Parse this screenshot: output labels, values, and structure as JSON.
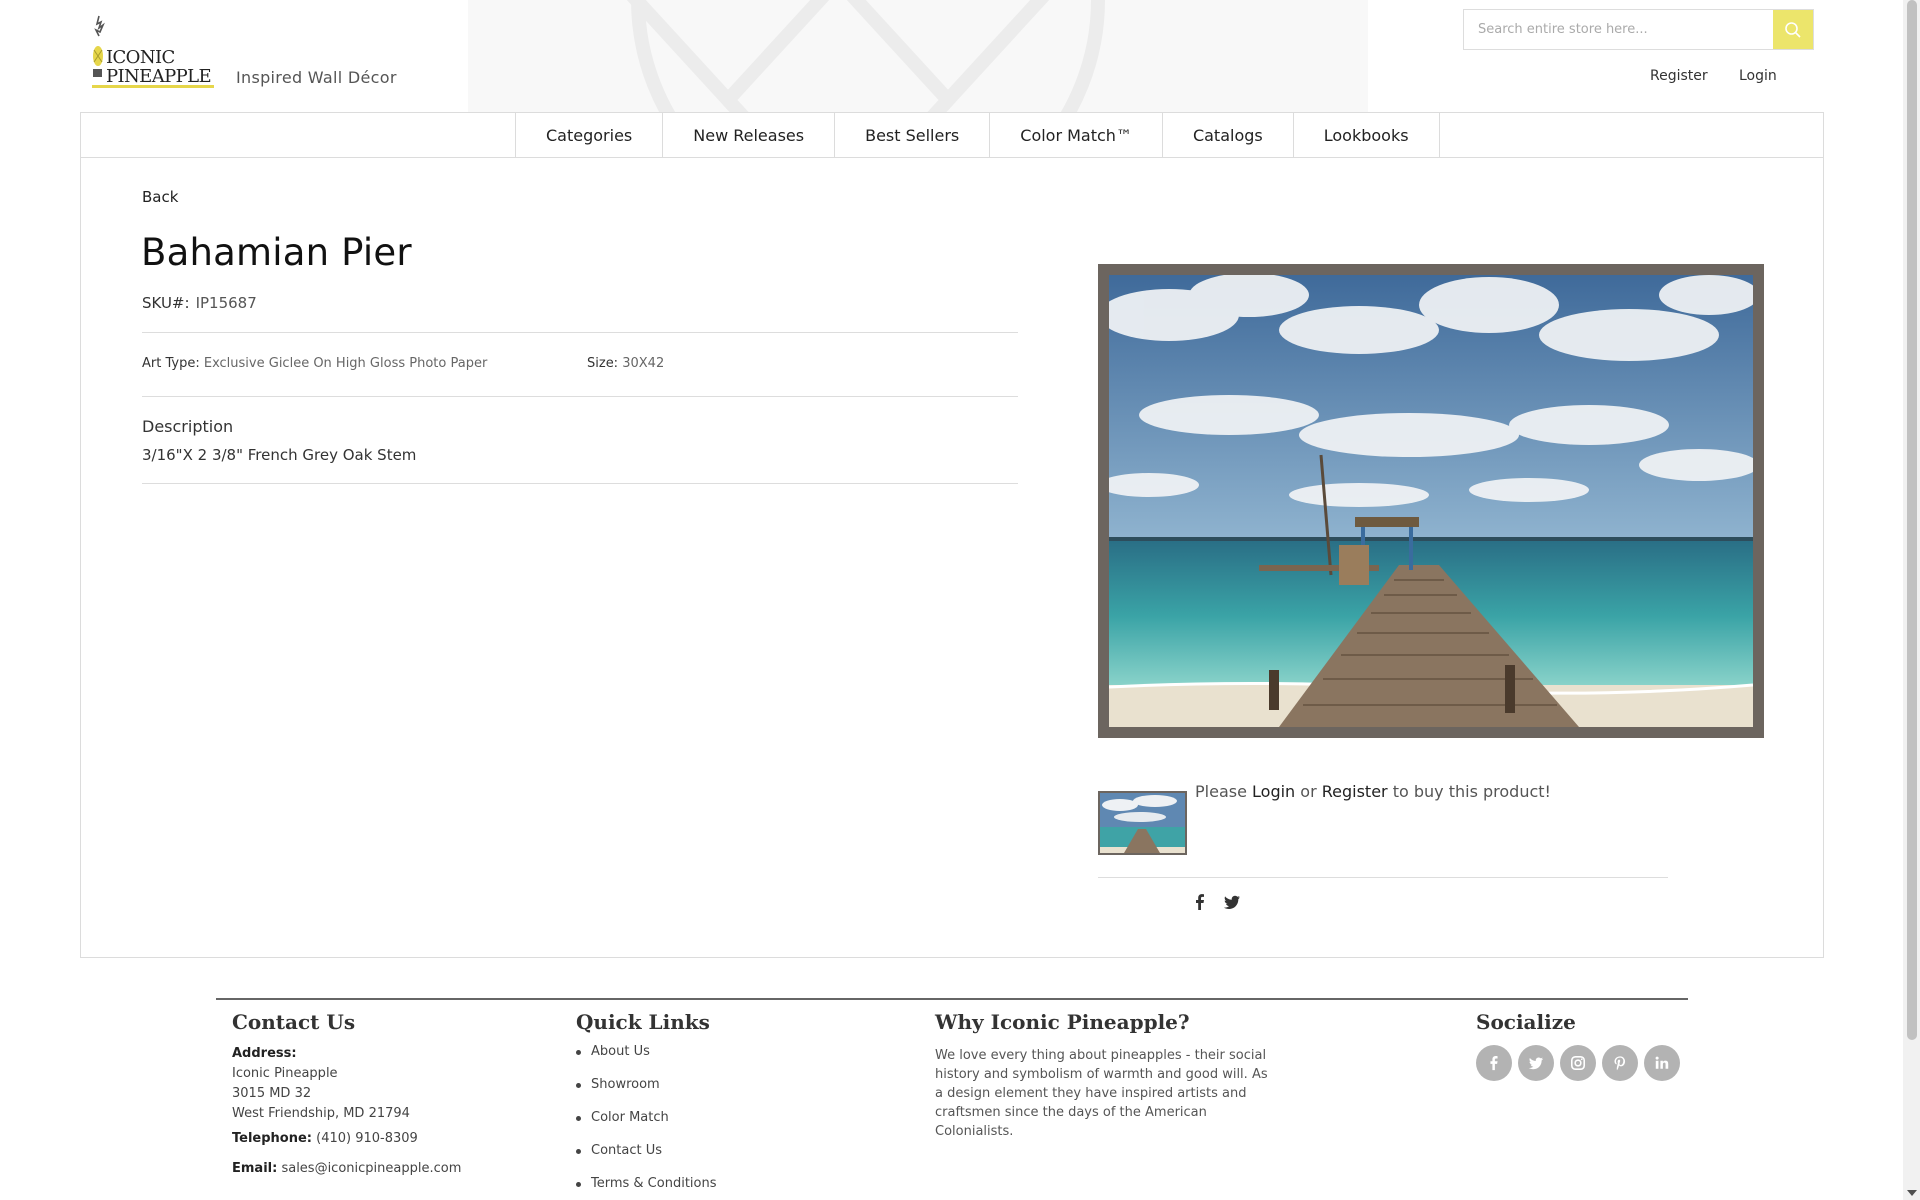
{
  "header": {
    "logo_line1": "ICONIC",
    "logo_line2": "PINEAPPLE",
    "tagline": "Inspired Wall Décor",
    "search_placeholder": "Search entire store here...",
    "register": "Register",
    "login": "Login"
  },
  "nav": {
    "items": [
      {
        "label": "Categories"
      },
      {
        "label": "New Releases"
      },
      {
        "label": "Best Sellers"
      },
      {
        "label": "Color Match™"
      },
      {
        "label": "Catalogs"
      },
      {
        "label": "Lookbooks"
      }
    ]
  },
  "product": {
    "back": "Back",
    "title": "Bahamian Pier",
    "sku_label": "SKU#:",
    "sku": "IP15687",
    "art_type_label": "Art Type:",
    "art_type": "Exclusive Giclee On High Gloss Photo Paper",
    "size_label": "Size:",
    "size": "30X42",
    "description_heading": "Description",
    "description": "3/16\"X 2 3/8\" French Grey Oak Stem",
    "buy_prefix": "Please",
    "buy_login": "Login",
    "buy_or": "or",
    "buy_register": "Register",
    "buy_suffix": "to buy this product!"
  },
  "footer": {
    "contact": {
      "heading": "Contact Us",
      "address_label": "Address:",
      "address_line1": "Iconic Pineapple",
      "address_line2": "3015 MD 32",
      "address_line3": "West Friendship, MD 21794",
      "telephone_label": "Telephone:",
      "telephone": "(410) 910-8309",
      "email_label": "Email:",
      "email": "sales@iconicpineapple.com"
    },
    "quick_links": {
      "heading": "Quick Links",
      "items": [
        {
          "label": "About Us"
        },
        {
          "label": "Showroom"
        },
        {
          "label": "Color Match"
        },
        {
          "label": "Contact Us"
        },
        {
          "label": "Terms & Conditions"
        }
      ]
    },
    "why": {
      "heading": "Why Iconic Pineapple?",
      "text": "We love every thing about pineapples - their social history and symbolism of warmth and good will. As a design element they have inspired artists and craftsmen since the days of the American Colonialists."
    },
    "socialize": {
      "heading": "Socialize",
      "icons": [
        "facebook-icon",
        "twitter-icon",
        "instagram-icon",
        "pinterest-icon",
        "linkedin-icon"
      ]
    }
  },
  "colors": {
    "accent_yellow": "#ece56b",
    "frame_grey": "#6c655f",
    "social_grey": "#b3b3b3"
  }
}
